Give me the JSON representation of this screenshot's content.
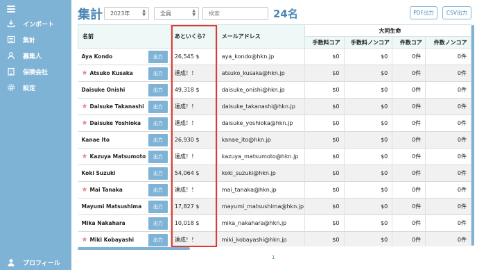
{
  "sidebar": {
    "items": [
      {
        "label": "インポート",
        "icon": "import-icon"
      },
      {
        "label": "集計",
        "icon": "list-icon"
      },
      {
        "label": "募集人",
        "icon": "person-icon"
      },
      {
        "label": "保険会社",
        "icon": "building-icon"
      },
      {
        "label": "設定",
        "icon": "gear-icon"
      }
    ],
    "profile": {
      "label": "プロフィール",
      "icon": "person-icon"
    }
  },
  "toolbar": {
    "title": "集計",
    "year_value": "2023年",
    "member_value": "全員",
    "search_placeholder": "検索",
    "count": "24名",
    "pdf_button": "PDF出力",
    "csv_button": "CSV出力"
  },
  "table": {
    "headers": {
      "name": "名前",
      "remaining": "あといくら？",
      "email": "メールアドレス",
      "group": "大同生命",
      "fee_core": "手数料コア",
      "fee_noncore": "手数料ノンコア",
      "count_core": "件数コア",
      "count_noncore": "件数ノンコア"
    },
    "output_label": "出力",
    "rows": [
      {
        "name": "Aya Kondo",
        "star": false,
        "remaining": "26,545 $",
        "email": "aya_kondo@hkn.jp",
        "fee_core": "$0",
        "fee_noncore": "$0",
        "count_core": "0件",
        "count_noncore": "0件"
      },
      {
        "name": "Atsuko Kusaka",
        "star": true,
        "remaining": "達成！！",
        "email": "atsuko_kusaka@hkn.jp",
        "fee_core": "$0",
        "fee_noncore": "$0",
        "count_core": "0件",
        "count_noncore": "0件"
      },
      {
        "name": "Daisuke Onishi",
        "star": false,
        "remaining": "49,318 $",
        "email": "daisuke_onishi@hkn.jp",
        "fee_core": "$0",
        "fee_noncore": "$0",
        "count_core": "0件",
        "count_noncore": "0件"
      },
      {
        "name": "Daisuke Takanashi",
        "star": true,
        "remaining": "達成！！",
        "email": "daisuke_takanashi@hkn.jp",
        "fee_core": "$0",
        "fee_noncore": "$0",
        "count_core": "0件",
        "count_noncore": "0件"
      },
      {
        "name": "Daisuke Yoshioka",
        "star": true,
        "remaining": "達成！！",
        "email": "daisuke_yoshioka@hkn.jp",
        "fee_core": "$0",
        "fee_noncore": "$0",
        "count_core": "0件",
        "count_noncore": "0件"
      },
      {
        "name": "Kanae Ito",
        "star": false,
        "remaining": "26,930 $",
        "email": "kanae_ito@hkn.jp",
        "fee_core": "$0",
        "fee_noncore": "$0",
        "count_core": "0件",
        "count_noncore": "0件"
      },
      {
        "name": "Kazuya Matsumoto",
        "star": true,
        "remaining": "達成！！",
        "email": "kazuya_matsumoto@hkn.jp",
        "fee_core": "$0",
        "fee_noncore": "$0",
        "count_core": "0件",
        "count_noncore": "0件"
      },
      {
        "name": "Koki Suzuki",
        "star": false,
        "remaining": "54,064 $",
        "email": "koki_suzuki@hkn.jp",
        "fee_core": "$0",
        "fee_noncore": "$0",
        "count_core": "0件",
        "count_noncore": "0件"
      },
      {
        "name": "Mai Tanaka",
        "star": true,
        "remaining": "達成！！",
        "email": "mai_tanaka@hkn.jp",
        "fee_core": "$0",
        "fee_noncore": "$0",
        "count_core": "0件",
        "count_noncore": "0件"
      },
      {
        "name": "Mayumi Matsushima",
        "star": false,
        "remaining": "17,827 $",
        "email": "mayumi_matsushima@hkn.jp",
        "fee_core": "$0",
        "fee_noncore": "$0",
        "count_core": "0件",
        "count_noncore": "0件"
      },
      {
        "name": "Mika Nakahara",
        "star": false,
        "remaining": "10,018 $",
        "email": "mika_nakahara@hkn.jp",
        "fee_core": "$0",
        "fee_noncore": "$0",
        "count_core": "0件",
        "count_noncore": "0件"
      },
      {
        "name": "Miki Kobayashi",
        "star": true,
        "remaining": "達成！！",
        "email": "miki_kobayashi@hkn.jp",
        "fee_core": "$0",
        "fee_noncore": "$0",
        "count_core": "0件",
        "count_noncore": "0件"
      }
    ]
  },
  "pagination": {
    "current": "1"
  },
  "colors": {
    "sidebar": "#7fb3d6",
    "accent": "#4a86b5",
    "highlight": "#e03a2f",
    "star": "#e58a8a"
  }
}
